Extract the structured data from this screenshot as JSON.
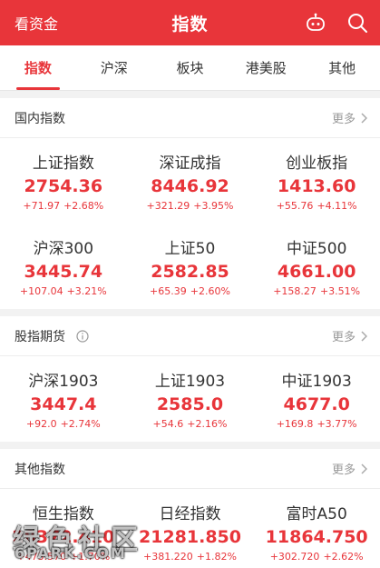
{
  "header": {
    "left_label": "看资金",
    "title": "指数",
    "icons": [
      "robot-icon",
      "search-icon"
    ]
  },
  "tabs": [
    "指数",
    "沪深",
    "板块",
    "港美股",
    "其他"
  ],
  "active_tab": 0,
  "sections": {
    "domestic": {
      "title": "国内指数",
      "more": "更多",
      "items": [
        {
          "name": "上证指数",
          "price": "2754.36",
          "change": "+71.97",
          "pct": "+2.68%"
        },
        {
          "name": "深证成指",
          "price": "8446.92",
          "change": "+321.29",
          "pct": "+3.95%"
        },
        {
          "name": "创业板指",
          "price": "1413.60",
          "change": "+55.76",
          "pct": "+4.11%"
        },
        {
          "name": "沪深300",
          "price": "3445.74",
          "change": "+107.04",
          "pct": "+3.21%"
        },
        {
          "name": "上证50",
          "price": "2582.85",
          "change": "+65.39",
          "pct": "+2.60%"
        },
        {
          "name": "中证500",
          "price": "4661.00",
          "change": "+158.27",
          "pct": "+3.51%"
        }
      ]
    },
    "futures": {
      "title": "股指期货",
      "more": "更多",
      "items": [
        {
          "name": "沪深1903",
          "price": "3447.4",
          "change": "+92.0",
          "pct": "+2.74%"
        },
        {
          "name": "上证1903",
          "price": "2585.0",
          "change": "+54.6",
          "pct": "+2.16%"
        },
        {
          "name": "中证1903",
          "price": "4677.0",
          "change": "+169.8",
          "pct": "+3.77%"
        }
      ]
    },
    "other": {
      "title": "其他指数",
      "more": "更多",
      "items": [
        {
          "name": "恒生指数",
          "price": "28372.410",
          "change": "+473.570",
          "pct": "+1.70%"
        },
        {
          "name": "日经指数",
          "price": "21281.850",
          "change": "+381.220",
          "pct": "+1.82%"
        },
        {
          "name": "富时A50",
          "price": "11864.750",
          "change": "+302.720",
          "pct": "+2.62%"
        }
      ]
    }
  },
  "watermark": {
    "text": "绿色社区",
    "sub": "6PARK.COM"
  },
  "colors": {
    "accent": "#e8353a",
    "up": "#e8353a"
  }
}
